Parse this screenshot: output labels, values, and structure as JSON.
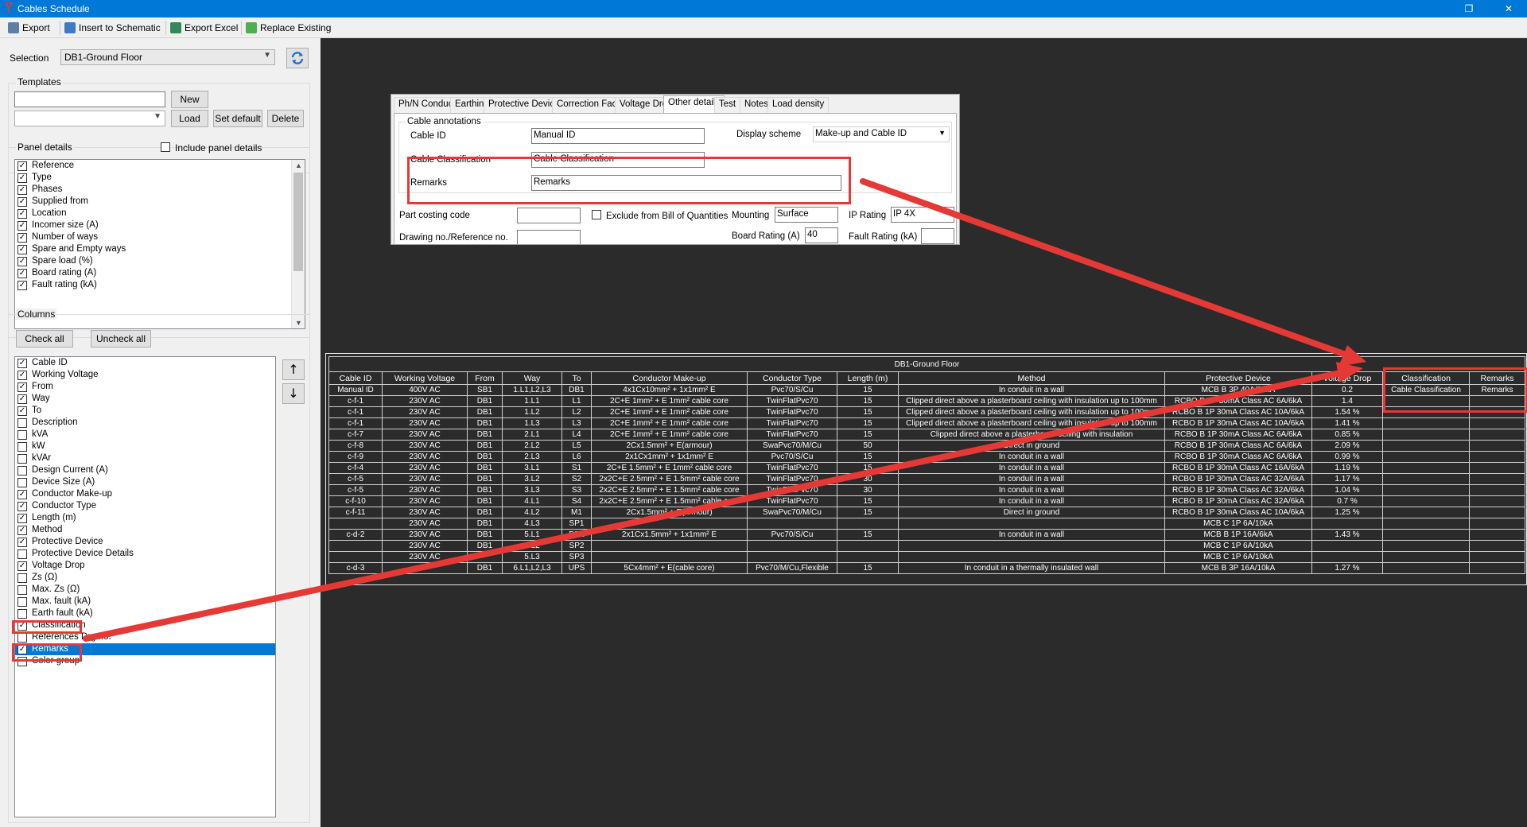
{
  "window": {
    "title": "Cables Schedule",
    "restore_glyph": "❐",
    "close_glyph": "✕"
  },
  "toolbar": {
    "export": "Export",
    "insert": "Insert to Schematic",
    "export_excel": "Export Excel",
    "replace": "Replace Existing"
  },
  "left": {
    "selection_label": "Selection",
    "selection_value": "DB1-Ground Floor",
    "templates_label": "Templates",
    "new_btn": "New",
    "load_btn": "Load",
    "set_default_btn": "Set default",
    "delete_btn": "Delete",
    "panel_details_label": "Panel details",
    "include_panel_details": "Include panel details",
    "panel_items": [
      {
        "label": "Reference",
        "checked": true
      },
      {
        "label": "Type",
        "checked": true
      },
      {
        "label": "Phases",
        "checked": true
      },
      {
        "label": "Supplied from",
        "checked": true
      },
      {
        "label": "Location",
        "checked": true
      },
      {
        "label": "Incomer size (A)",
        "checked": true
      },
      {
        "label": "Number of ways",
        "checked": true
      },
      {
        "label": "Spare and Empty ways",
        "checked": true
      },
      {
        "label": "Spare load (%)",
        "checked": true
      },
      {
        "label": "Board rating (A)",
        "checked": true
      },
      {
        "label": "Fault rating (kA)",
        "checked": true
      }
    ],
    "columns_label": "Columns",
    "check_all": "Check all",
    "uncheck_all": "Uncheck all",
    "column_items": [
      {
        "label": "Cable ID",
        "checked": true
      },
      {
        "label": "Working Voltage",
        "checked": true
      },
      {
        "label": "From",
        "checked": true
      },
      {
        "label": "Way",
        "checked": true
      },
      {
        "label": "To",
        "checked": true
      },
      {
        "label": "Description",
        "checked": false
      },
      {
        "label": "kVA",
        "checked": false
      },
      {
        "label": "kW",
        "checked": false
      },
      {
        "label": "kVAr",
        "checked": false
      },
      {
        "label": "Design Current (A)",
        "checked": false
      },
      {
        "label": "Device Size (A)",
        "checked": false
      },
      {
        "label": "Conductor Make-up",
        "checked": true
      },
      {
        "label": "Conductor Type",
        "checked": true
      },
      {
        "label": "Length (m)",
        "checked": true
      },
      {
        "label": "Method",
        "checked": true
      },
      {
        "label": "Protective Device",
        "checked": true
      },
      {
        "label": "Protective Device Details",
        "checked": false
      },
      {
        "label": "Voltage Drop",
        "checked": true
      },
      {
        "label": "Zs (Ω)",
        "checked": false
      },
      {
        "label": "Max. Zs (Ω)",
        "checked": false
      },
      {
        "label": "Max. fault (kA)",
        "checked": false
      },
      {
        "label": "Earth fault (kA)",
        "checked": false
      },
      {
        "label": "Classification",
        "checked": true
      },
      {
        "label": "References Drg no.",
        "checked": false
      },
      {
        "label": "Remarks",
        "checked": true,
        "selected": true
      },
      {
        "label": "Color group",
        "checked": false
      }
    ]
  },
  "dialog": {
    "tabs": [
      "Ph/N Conductor",
      "Earthing",
      "Protective Devices",
      "Correction Factors",
      "Voltage Drop",
      "Other details",
      "Test",
      "Notes",
      "Load density"
    ],
    "active_tab": "Other details",
    "group_label": "Cable annotations",
    "cable_id_label": "Cable ID",
    "cable_id_value": "Manual ID",
    "display_scheme_label": "Display scheme",
    "display_scheme_value": "Make-up and Cable ID",
    "classification_label": "Cable Classification",
    "classification_value": "Cable Classification",
    "remarks_label": "Remarks",
    "remarks_value": "Remarks",
    "part_costing_label": "Part costing code",
    "exclude_label": "Exclude from Bill of Quantities",
    "mounting_label": "Mounting",
    "mounting_value": "Surface",
    "ip_label": "IP Rating",
    "ip_value": "IP 4X",
    "drawing_label": "Drawing no./Reference no.",
    "board_rating_label": "Board Rating (A)",
    "board_rating_value": "40",
    "fault_rating_label": "Fault Rating (kA)"
  },
  "schedule": {
    "title": "DB1-Ground Floor",
    "headers": [
      "Cable ID",
      "Working Voltage",
      "From",
      "Way",
      "To",
      "Conductor Make-up",
      "Conductor Type",
      "Length (m)",
      "Method",
      "Protective Device",
      "Voltage Drop",
      "Classification",
      "Remarks"
    ],
    "rows": [
      [
        "Manual ID",
        "400V AC",
        "SB1",
        "1.L1,L2,L3",
        "DB1",
        "4x1Cx10mm² + 1x1mm² E",
        "Pvc70/S/Cu",
        "15",
        "In conduit in a wall",
        "MCB B 3P 40A/20kA",
        "0.2",
        "Cable Classification",
        "Remarks"
      ],
      [
        "c-f-1",
        "230V AC",
        "DB1",
        "1.L1",
        "L1",
        "2C+E 1mm² + E 1mm² cable core",
        "TwinFlatPvc70",
        "15",
        "Clipped direct above a plasterboard ceiling with insulation up to 100mm",
        "RCBO B 1P 30mA Class AC 6A/6kA",
        "1.4",
        "",
        ""
      ],
      [
        "c-f-1",
        "230V AC",
        "DB1",
        "1.L2",
        "L2",
        "2C+E 1mm² + E 1mm² cable core",
        "TwinFlatPvc70",
        "15",
        "Clipped direct above a plasterboard ceiling with insulation up to 100mm",
        "RCBO B 1P 30mA Class AC 10A/6kA",
        "1.54 %",
        "",
        ""
      ],
      [
        "c-f-1",
        "230V AC",
        "DB1",
        "1.L3",
        "L3",
        "2C+E 1mm² + E 1mm² cable core",
        "TwinFlatPvc70",
        "15",
        "Clipped direct above a plasterboard ceiling with insulation up to 100mm",
        "RCBO B 1P 30mA Class AC 10A/6kA",
        "1.41 %",
        "",
        ""
      ],
      [
        "c-f-7",
        "230V AC",
        "DB1",
        "2.L1",
        "L4",
        "2C+E 1mm² + E 1mm² cable core",
        "TwinFlatPvc70",
        "15",
        "Clipped direct above a plasterboard ceiling with insulation",
        "RCBO B 1P 30mA Class AC 6A/6kA",
        "0.85 %",
        "",
        ""
      ],
      [
        "c-f-8",
        "230V AC",
        "DB1",
        "2.L2",
        "L5",
        "2Cx1.5mm² + E(armour)",
        "SwaPvc70/M/Cu",
        "50",
        "Direct in ground",
        "RCBO B 1P 30mA Class AC 6A/6kA",
        "2.09 %",
        "",
        ""
      ],
      [
        "c-f-9",
        "230V AC",
        "DB1",
        "2.L3",
        "L6",
        "2x1Cx1mm² + 1x1mm² E",
        "Pvc70/S/Cu",
        "15",
        "In conduit in a wall",
        "RCBO B 1P 30mA Class AC 6A/6kA",
        "0.99 %",
        "",
        ""
      ],
      [
        "c-f-4",
        "230V AC",
        "DB1",
        "3.L1",
        "S1",
        "2C+E 1.5mm² + E 1mm² cable core",
        "TwinFlatPvc70",
        "15",
        "In conduit in a wall",
        "RCBO B 1P 30mA Class AC 16A/6kA",
        "1.19 %",
        "",
        ""
      ],
      [
        "c-f-5",
        "230V AC",
        "DB1",
        "3.L2",
        "S2",
        "2x2C+E 2.5mm² + E 1.5mm² cable core",
        "TwinFlatPvc70",
        "30",
        "In conduit in a wall",
        "RCBO B 1P 30mA Class AC 32A/6kA",
        "1.17 %",
        "",
        ""
      ],
      [
        "c-f-5",
        "230V AC",
        "DB1",
        "3.L3",
        "S3",
        "2x2C+E 2.5mm² + E 1.5mm² cable core",
        "TwinFlatPvc70",
        "30",
        "In conduit in a wall",
        "RCBO B 1P 30mA Class AC 32A/6kA",
        "1.04 %",
        "",
        ""
      ],
      [
        "c-f-10",
        "230V AC",
        "DB1",
        "4.L1",
        "S4",
        "2x2C+E 2.5mm² + E 1.5mm² cable core",
        "TwinFlatPvc70",
        "15",
        "In conduit in a wall",
        "RCBO B 1P 30mA Class AC 32A/6kA",
        "0.7 %",
        "",
        ""
      ],
      [
        "c-f-11",
        "230V AC",
        "DB1",
        "4.L2",
        "M1",
        "2Cx1.5mm² + E(armour)",
        "SwaPvc70/M/Cu",
        "15",
        "Direct in ground",
        "RCBO B 1P 30mA Class AC 10A/6kA",
        "1.25 %",
        "",
        ""
      ],
      [
        "",
        "230V AC",
        "DB1",
        "4.L3",
        "SP1",
        "",
        "",
        "",
        "",
        "MCB C 1P 6A/10kA",
        "",
        "",
        ""
      ],
      [
        "c-d-2",
        "230V AC",
        "DB1",
        "5.L1",
        "DB2",
        "2x1Cx1.5mm² + 1x1mm² E",
        "Pvc70/S/Cu",
        "15",
        "In conduit in a wall",
        "MCB B 1P 16A/6kA",
        "1.43 %",
        "",
        ""
      ],
      [
        "",
        "230V AC",
        "DB1",
        "5.L2",
        "SP2",
        "",
        "",
        "",
        "",
        "MCB C 1P 6A/10kA",
        "",
        "",
        ""
      ],
      [
        "",
        "230V AC",
        "",
        "5.L3",
        "SP3",
        "",
        "",
        "",
        "",
        "MCB C 1P 6A/10kA",
        "",
        "",
        ""
      ],
      [
        "c-d-3",
        "",
        "DB1",
        "6.L1,L2,L3",
        "UPS",
        "5Cx4mm² + E(cable core)",
        "Pvc70/M/Cu,Flexible",
        "15",
        "In conduit in a thermally insulated wall",
        "MCB B 3P 16A/10kA",
        "1.27 %",
        "",
        ""
      ]
    ]
  },
  "colors": {
    "accent": "#0078d7",
    "annotation": "#e53935",
    "canvas": "#2b2b2b"
  }
}
